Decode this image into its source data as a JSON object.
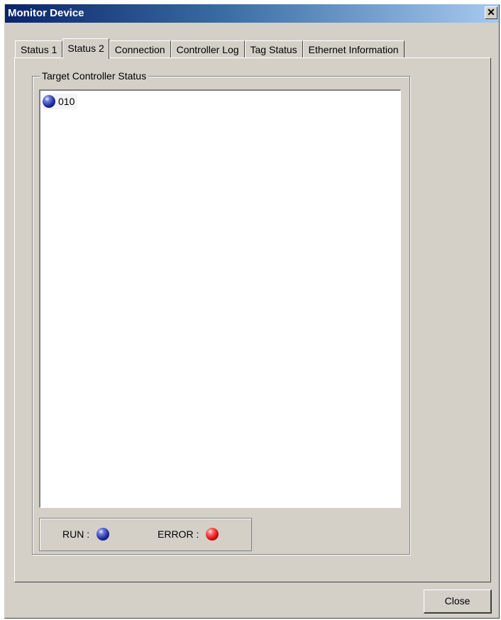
{
  "window": {
    "title": "Monitor Device",
    "close_glyph": "✕"
  },
  "tabs": [
    {
      "label": "Status 1",
      "active": false
    },
    {
      "label": "Status 2",
      "active": true
    },
    {
      "label": "Connection",
      "active": false
    },
    {
      "label": "Controller Log",
      "active": false
    },
    {
      "label": "Tag Status",
      "active": false
    },
    {
      "label": "Ethernet Information",
      "active": false
    }
  ],
  "target_status": {
    "group_title": "Target Controller Status",
    "items": [
      {
        "label": "010",
        "state": "run",
        "icon": "blue-status-ball"
      }
    ]
  },
  "legend": {
    "run_label": "RUN :",
    "run_color": "#1b2a9c",
    "error_label": "ERROR :",
    "error_color": "#d81010"
  },
  "buttons": {
    "close_label": "Close"
  }
}
